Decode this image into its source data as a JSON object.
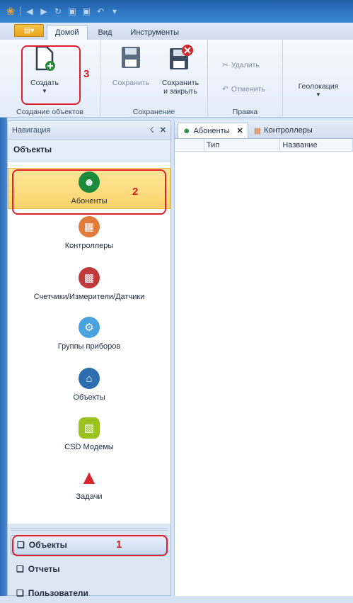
{
  "titlebar": {
    "icons": [
      "app-icon",
      "back-icon",
      "forward-icon",
      "refresh-icon",
      "save-icon",
      "save-close-icon",
      "undo-icon",
      "customize-icon"
    ]
  },
  "ribbon_tabs": [
    {
      "label": "Домой"
    },
    {
      "label": "Вид"
    },
    {
      "label": "Инструменты"
    }
  ],
  "ribbon": {
    "create": {
      "label": "Создать",
      "marker": "3"
    },
    "save": {
      "label": "Сохранить"
    },
    "save_close": {
      "line1": "Сохранить",
      "line2": "и закрыть"
    },
    "delete": {
      "label": "Удалить"
    },
    "cancel": {
      "label": "Отменить"
    },
    "geolocation": {
      "label": "Геолокация"
    },
    "groups": {
      "create_objects": "Создание объектов",
      "saving": "Сохранение",
      "edit": "Правка"
    }
  },
  "nav": {
    "header": "Навигация",
    "section_title": "Объекты",
    "items": [
      {
        "label": "Абоненты",
        "color": "#1e8a3c",
        "marker": "2"
      },
      {
        "label": "Контроллеры",
        "color": "#e07b39"
      },
      {
        "label": "Счетчики/Измерители/Датчики",
        "color": "#c0393b"
      },
      {
        "label": "Группы приборов",
        "color": "#4aa3df"
      },
      {
        "label": "Объекты",
        "color": "#2d6fae"
      },
      {
        "label": "CSD Модемы",
        "color": "#9bc21f"
      },
      {
        "label": "Задачи",
        "color": "#d6262b"
      }
    ],
    "bottom": [
      {
        "label": "Объекты",
        "marker": "1"
      },
      {
        "label": "Отчеты"
      },
      {
        "label": "Пользователи"
      }
    ]
  },
  "documents": {
    "tabs": [
      {
        "label": "Абоненты"
      },
      {
        "label": "Контроллеры"
      }
    ],
    "columns": [
      "Тип",
      "Название"
    ]
  },
  "colors": {
    "highlight": "#e0202a",
    "selected": "#fbd46b"
  }
}
